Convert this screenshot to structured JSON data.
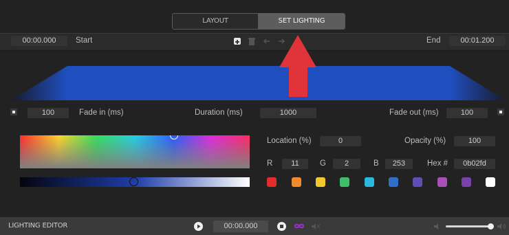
{
  "tabs": {
    "layout": "LAYOUT",
    "set_lighting": "SET LIGHTING",
    "active": "set_lighting"
  },
  "timeline": {
    "start_time": "00:00.000",
    "start_label": "Start",
    "end_label": "End",
    "end_time": "00:01.200"
  },
  "fade": {
    "fade_in_value": "100",
    "fade_in_label": "Fade in (ms)",
    "duration_label": "Duration (ms)",
    "duration_value": "1000",
    "fade_out_label": "Fade out (ms)",
    "fade_out_value": "100"
  },
  "color": {
    "location_label": "Location (%)",
    "location_value": "0",
    "opacity_label": "Opacity (%)",
    "opacity_value": "100",
    "r_label": "R",
    "r_value": "11",
    "g_label": "G",
    "g_value": "2",
    "b_label": "B",
    "b_value": "253",
    "hex_label": "Hex #",
    "hex_value": "0b02fd",
    "current": "#0b02fd",
    "swatches": [
      "#e32d2d",
      "#f08a2a",
      "#f2c92d",
      "#3fbe6a",
      "#2cb8dc",
      "#2e6fc7",
      "#5f4fb5",
      "#a94fb8",
      "#7a42a8",
      "#ffffff"
    ]
  },
  "footer": {
    "title": "LIGHTING EDITOR",
    "time": "00:00.000"
  },
  "colors": {
    "accent_arrow": "#e0333a",
    "gradient_blue": "#1f4fbf",
    "loop_icon": "#9b2fd1"
  }
}
